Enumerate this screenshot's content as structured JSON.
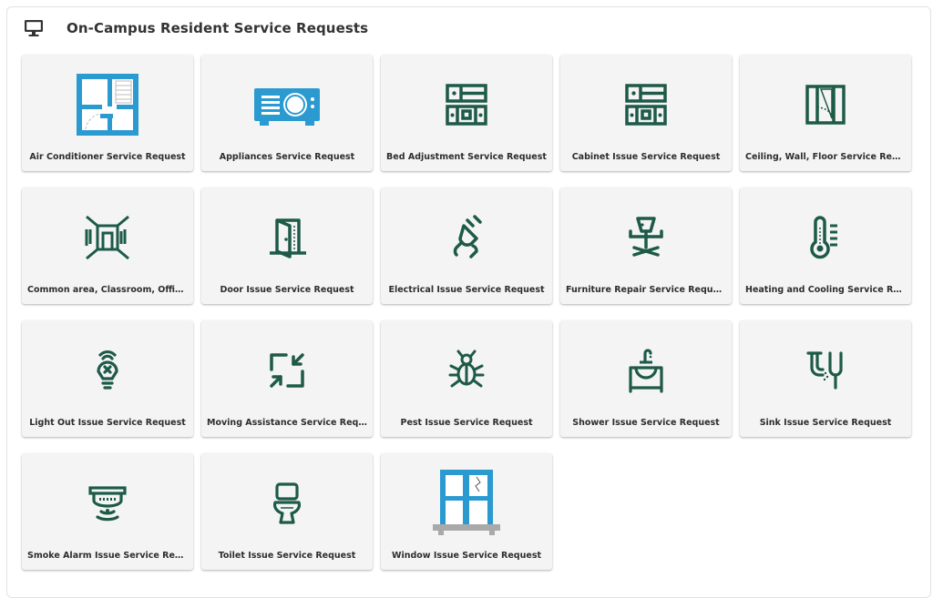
{
  "header": {
    "title": "On-Campus Resident Service Requests",
    "icon": "monitor-icon"
  },
  "colors": {
    "icon_green": "#1d5a47",
    "icon_blue": "#2b9ad1",
    "tile_bg": "#f4f4f4"
  },
  "tiles": [
    {
      "label": "Air Conditioner Service Request",
      "icon": "floor-plan-icon"
    },
    {
      "label": "Appliances Service Request",
      "icon": "projector-icon"
    },
    {
      "label": "Bed Adjustment Service Request",
      "icon": "drawers-icon"
    },
    {
      "label": "Cabinet Issue Service Request",
      "icon": "drawers-icon"
    },
    {
      "label": "Ceiling, Wall, Floor Service Requ...",
      "icon": "wall-corner-icon"
    },
    {
      "label": "Common area, Classroom, Offic...",
      "icon": "room-perspective-icon"
    },
    {
      "label": "Door Issue Service Request",
      "icon": "door-icon"
    },
    {
      "label": "Electrical Issue Service Request",
      "icon": "plug-icon"
    },
    {
      "label": "Furniture Repair Service Request",
      "icon": "office-chair-icon"
    },
    {
      "label": "Heating and Cooling Service Req...",
      "icon": "thermometer-icon"
    },
    {
      "label": "Light Out Issue Service Request",
      "icon": "light-bulb-icon"
    },
    {
      "label": "Moving Assistance Service Requ...",
      "icon": "collapse-arrows-icon"
    },
    {
      "label": "Pest Issue Service Request",
      "icon": "bug-icon"
    },
    {
      "label": "Shower Issue Service Request",
      "icon": "sink-vanity-icon"
    },
    {
      "label": "Sink Issue Service Request",
      "icon": "pipe-sink-icon"
    },
    {
      "label": "Smoke Alarm Issue Service Req...",
      "icon": "smoke-alarm-icon"
    },
    {
      "label": "Toilet Issue Service Request",
      "icon": "toilet-icon"
    },
    {
      "label": "Window Issue Service Request",
      "icon": "window-icon"
    }
  ]
}
